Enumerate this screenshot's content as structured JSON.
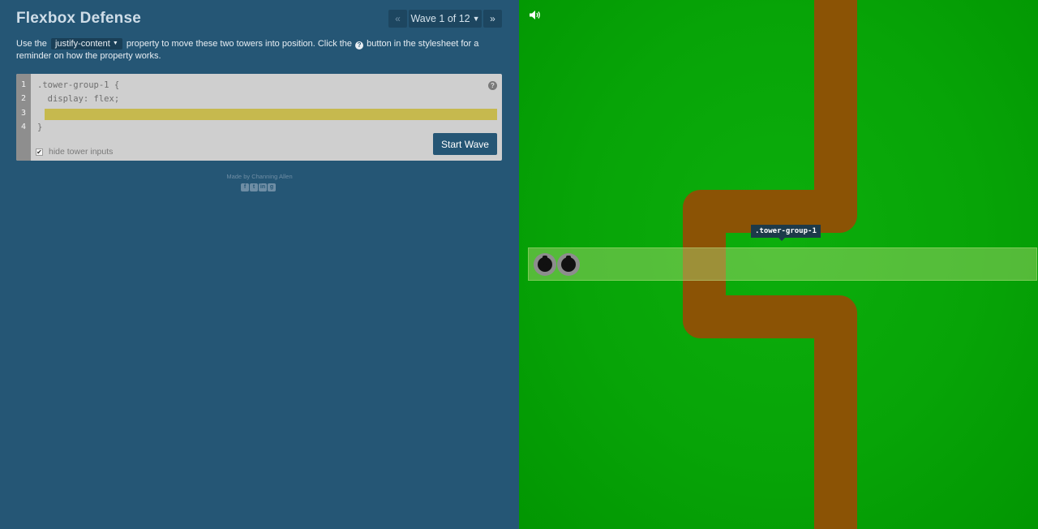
{
  "header": {
    "title": "Flexbox Defense",
    "prev_label": "«",
    "wave_label": "Wave 1 of 12",
    "next_label": "»"
  },
  "instructions": {
    "part1": "Use the",
    "property": "justify-content",
    "part2": "property to move these two towers into position. Click the",
    "help_glyph": "?",
    "part3": "button in the stylesheet for a reminder on how the property works."
  },
  "editor": {
    "line_numbers": [
      "1",
      "2",
      "3",
      "4"
    ],
    "lines": [
      ".tower-group-1 {",
      "  display: flex;",
      "",
      "}"
    ],
    "input_value": "",
    "help_label": "?",
    "hide_inputs_label": "hide tower inputs",
    "hide_inputs_checked": true,
    "start_label": "Start Wave"
  },
  "footer": {
    "credit": "Made by Channing Allen",
    "social_icons": [
      "facebook-icon",
      "twitter-icon",
      "linkedin-icon",
      "github-icon"
    ]
  },
  "game": {
    "tower_group_label": ".tower-group-1",
    "towers": [
      "tower-1",
      "tower-2"
    ],
    "colors": {
      "grass": "#07a407",
      "path": "#8b5305",
      "panel": "#255675",
      "editor_input_highlight": "#c6b94e"
    }
  }
}
